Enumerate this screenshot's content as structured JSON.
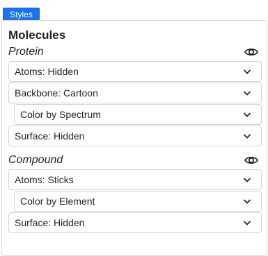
{
  "tab": {
    "label": "Styles"
  },
  "panel": {
    "title": "Molecules"
  },
  "sections": [
    {
      "label": "Protein",
      "visibility_icon": "eye-icon",
      "rows": [
        {
          "label": "Atoms: Hidden",
          "indent": false
        },
        {
          "label": "Backbone: Cartoon",
          "indent": false
        },
        {
          "label": "Color by Spectrum",
          "indent": true
        },
        {
          "label": "Surface: Hidden",
          "indent": false
        }
      ]
    },
    {
      "label": "Compound",
      "visibility_icon": "eye-icon",
      "rows": [
        {
          "label": "Atoms: Sticks",
          "indent": false
        },
        {
          "label": "Color by Element",
          "indent": true
        },
        {
          "label": "Surface: Hidden",
          "indent": false
        }
      ]
    }
  ],
  "colors": {
    "accent": "#1a73e8",
    "border": "#cfd4da"
  }
}
